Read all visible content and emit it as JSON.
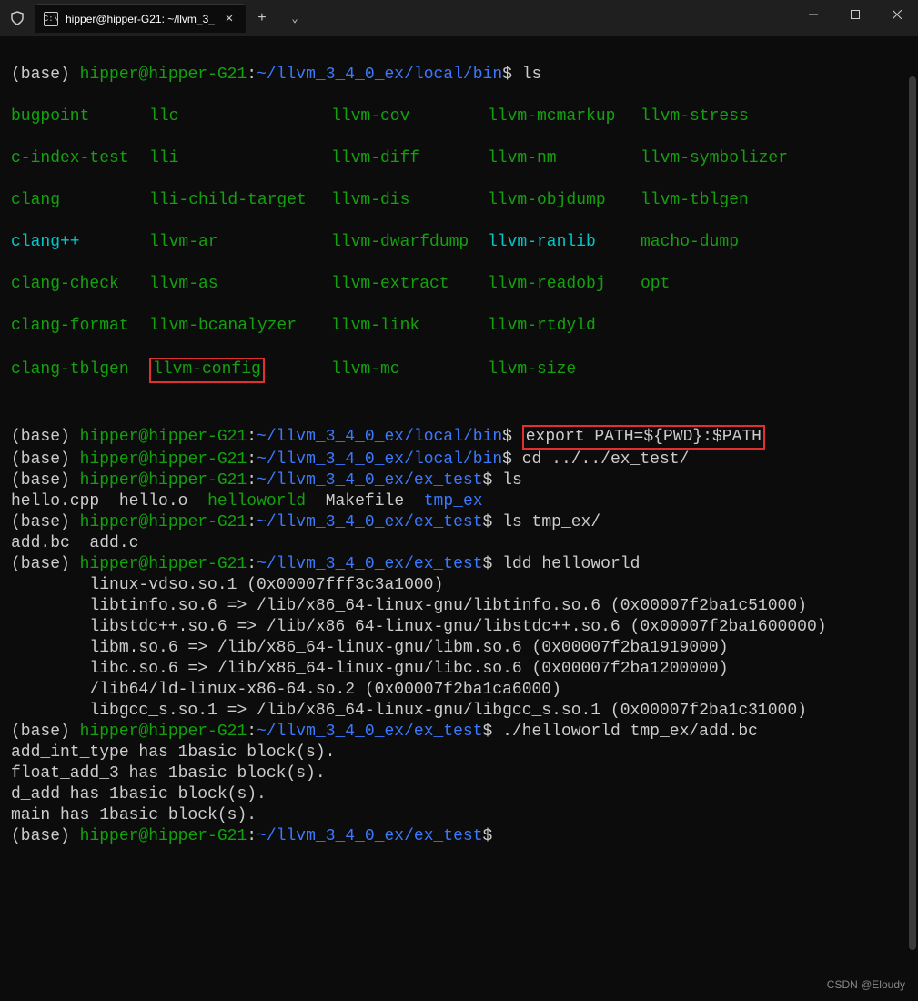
{
  "titlebar": {
    "tab_title": "hipper@hipper-G21: ~/llvm_3_",
    "tab_close": "✕",
    "new_tab": "+",
    "dropdown": "⌄",
    "min": "—",
    "max": "□",
    "close": "✕",
    "tab_icon_text": "C:\\"
  },
  "prompt": {
    "env": "(base) ",
    "userhost": "hipper@hipper-G21",
    "colon": ":",
    "dollar": "$ ",
    "path_bin": "~/llvm_3_4_0_ex/local/bin",
    "path_extest": "~/llvm_3_4_0_ex/ex_test"
  },
  "commands": {
    "ls1": "ls",
    "export": "export PATH=${PWD}:$PATH",
    "cd": "cd ../../ex_test/",
    "ls2": "ls",
    "ls_tmp": "ls tmp_ex/",
    "ldd": "ldd helloworld",
    "run": "./helloworld tmp_ex/add.bc"
  },
  "ls_bin": {
    "rows": [
      [
        "bugpoint",
        "llc",
        "llvm-cov",
        "llvm-mcmarkup",
        "llvm-stress"
      ],
      [
        "c-index-test",
        "lli",
        "llvm-diff",
        "llvm-nm",
        "llvm-symbolizer"
      ],
      [
        "clang",
        "lli-child-target",
        "llvm-dis",
        "llvm-objdump",
        "llvm-tblgen"
      ],
      [
        "clang++",
        "llvm-ar",
        "llvm-dwarfdump",
        "llvm-ranlib",
        "macho-dump"
      ],
      [
        "clang-check",
        "llvm-as",
        "llvm-extract",
        "llvm-readobj",
        "opt"
      ],
      [
        "clang-format",
        "llvm-bcanalyzer",
        "llvm-link",
        "llvm-rtdyld",
        ""
      ],
      [
        "clang-tblgen",
        "llvm-config",
        "llvm-mc",
        "llvm-size",
        ""
      ]
    ]
  },
  "ls_extest": {
    "hello_cpp": "hello.cpp",
    "hello_o": "hello.o",
    "helloworld": "helloworld",
    "makefile": "Makefile",
    "tmp_ex": "tmp_ex"
  },
  "ls_tmpex": {
    "add_bc": "add.bc",
    "add_c": "add.c"
  },
  "ldd_output": [
    "        linux-vdso.so.1 (0x00007fff3c3a1000)",
    "        libtinfo.so.6 => /lib/x86_64-linux-gnu/libtinfo.so.6 (0x00007f2ba1c51000)",
    "        libstdc++.so.6 => /lib/x86_64-linux-gnu/libstdc++.so.6 (0x00007f2ba1600000)",
    "        libm.so.6 => /lib/x86_64-linux-gnu/libm.so.6 (0x00007f2ba1919000)",
    "        libc.so.6 => /lib/x86_64-linux-gnu/libc.so.6 (0x00007f2ba1200000)",
    "        /lib64/ld-linux-x86-64.so.2 (0x00007f2ba1ca6000)",
    "        libgcc_s.so.1 => /lib/x86_64-linux-gnu/libgcc_s.so.1 (0x00007f2ba1c31000)"
  ],
  "run_output": [
    "add_int_type has 1basic block(s).",
    "float_add_3 has 1basic block(s).",
    "d_add has 1basic block(s).",
    "main has 1basic block(s)."
  ],
  "watermark": "CSDN @Eloudy"
}
